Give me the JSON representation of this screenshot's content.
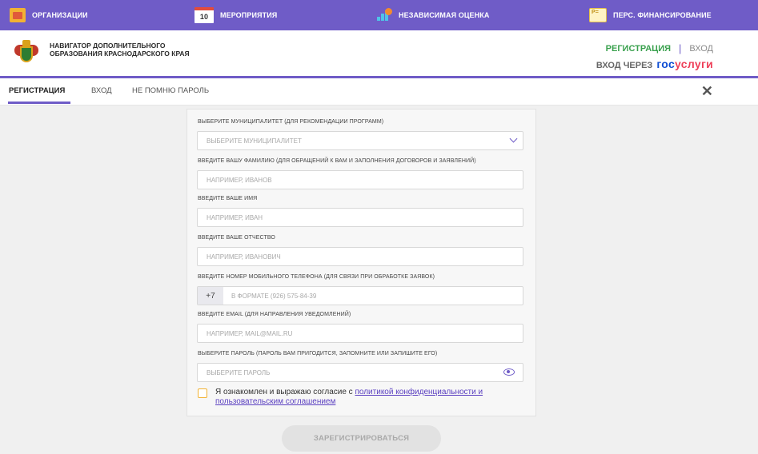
{
  "topbar": {
    "items": [
      {
        "label": "ОРГАНИЗАЦИИ",
        "icon": "organizations-icon"
      },
      {
        "label": "МЕРОПРИЯТИЯ",
        "icon": "calendar-icon",
        "icon_text": "10"
      },
      {
        "label": "НЕЗАВИСИМАЯ ОЦЕНКА",
        "icon": "chart-icon"
      },
      {
        "label": "ПЕРС. ФИНАНСИРОВАНИЕ",
        "icon": "certificate-icon"
      }
    ]
  },
  "header": {
    "org_name": "НАВИГАТОР ДОПОЛНИТЕЛЬНОГО ОБРАЗОВАНИЯ КРАСНОДАРСКОГО КРАЯ",
    "register_link": "РЕГИСТРАЦИЯ",
    "separator": "|",
    "login_link": "ВХОД",
    "gosuslugi_prefix": "ВХОД ЧЕРЕЗ",
    "gosuslugi_part1": "гос",
    "gosuslugi_part2": "услуги"
  },
  "tabs": {
    "items": [
      "РЕГИСТРАЦИЯ",
      "ВХОД",
      "НЕ ПОМНЮ ПАРОЛЬ"
    ],
    "active": "РЕГИСТРАЦИЯ",
    "close_symbol": "✕"
  },
  "form": {
    "municipality": {
      "label": "ВЫБЕРИТЕ МУНИЦИПАЛИТЕТ (ДЛЯ РЕКОМЕНДАЦИИ ПРОГРАММ)",
      "placeholder": "ВЫБЕРИТЕ МУНИЦИПАЛИТЕТ"
    },
    "surname": {
      "label": "ВВЕДИТЕ ВАШУ ФАМИЛИЮ (ДЛЯ ОБРАЩЕНИЙ К ВАМ И ЗАПОЛНЕНИЯ ДОГОВОРОВ И ЗАЯВЛЕНИЙ)",
      "placeholder": "НАПРИМЕР, ИВАНОВ"
    },
    "name": {
      "label": "ВВЕДИТЕ ВАШЕ ИМЯ",
      "placeholder": "НАПРИМЕР, ИВАН"
    },
    "patronymic": {
      "label": "ВВЕДИТЕ ВАШЕ ОТЧЕСТВО",
      "placeholder": "НАПРИМЕР, ИВАНОВИЧ"
    },
    "phone": {
      "label": "ВВЕДИТЕ НОМЕР МОБИЛЬНОГО ТЕЛЕФОНА (ДЛЯ СВЯЗИ ПРИ ОБРАБОТКЕ ЗАЯВОК)",
      "prefix": "+7",
      "placeholder": "В ФОРМАТЕ (926) 575-84-39"
    },
    "email": {
      "label": "ВВЕДИТЕ EMAIL (ДЛЯ НАПРАВЛЕНИЯ УВЕДОМЛЕНИЙ)",
      "placeholder": "НАПРИМЕР, MAIL@MAIL.RU"
    },
    "password": {
      "label": "ВЫБЕРИТЕ ПАРОЛЬ (ПАРОЛЬ ВАМ ПРИГОДИТСЯ, ЗАПОМНИТЕ ИЛИ ЗАПИШИТЕ ЕГО)",
      "placeholder": "ВЫБЕРИТЕ ПАРОЛЬ"
    },
    "consent": {
      "text": "Я ознакомлен и выражаю согласие с ",
      "link": "политикой конфиденциальности и пользовательским соглашением",
      "checked": false
    },
    "submit_label": "ЗАРЕГИСТРИРОВАТЬСЯ"
  },
  "colors": {
    "brand": "#6f5cc7",
    "register": "#3aa14e",
    "gosuslugi_blue": "#0d4cd3",
    "gosuslugi_red": "#ee3f58",
    "checkbox_border": "#f2b233"
  }
}
